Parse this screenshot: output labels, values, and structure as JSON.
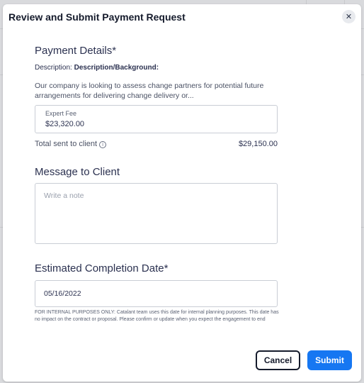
{
  "modal": {
    "title": "Review and Submit Payment Request",
    "close_icon": "close-icon"
  },
  "payment": {
    "heading": "Payment Details*",
    "description_label": "Description:",
    "description_title": "Description/Background:",
    "description_text": "Our company is looking to assess change partners for potential future arrangements for delivering change delivery or...",
    "fee_label": "Expert Fee",
    "fee_value": "$23,320.00",
    "total_label": "Total sent to client",
    "total_info_icon": "info-icon",
    "total_value": "$29,150.00"
  },
  "message": {
    "heading": "Message to Client",
    "placeholder": "Write a note",
    "value": ""
  },
  "completion": {
    "heading": "Estimated Completion Date*",
    "date_value": "05/16/2022",
    "internal_note": "FOR INTERNAL PURPOSES ONLY: Catalant team uses this date for internal planning purposes. This date has no impact on the contract or proposal. Please confirm or update when you expect the engagement to end"
  },
  "actions": {
    "cancel_label": "Cancel",
    "submit_label": "Submit"
  },
  "colors": {
    "primary": "#1677f2",
    "text_dark": "#151b2c",
    "backdrop": "#d9dadd"
  }
}
